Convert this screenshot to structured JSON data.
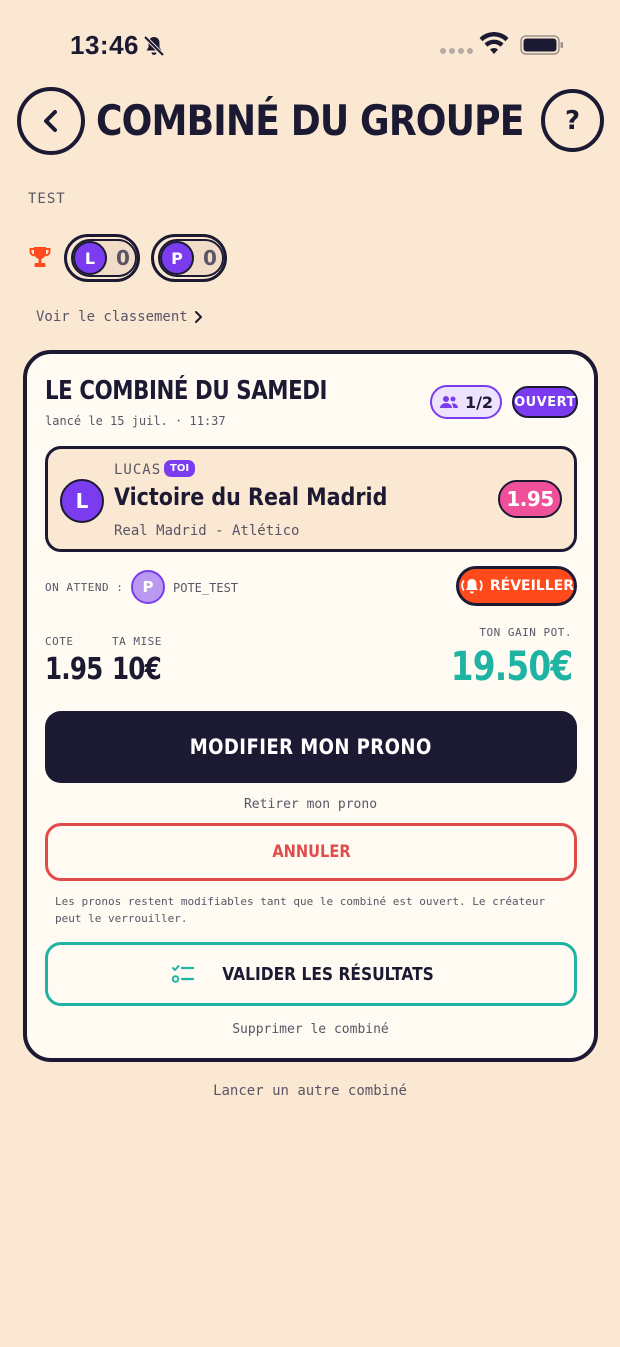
{
  "status_bar": {
    "time": "13:46"
  },
  "header": {
    "title": "COMBINÉ DU GROUPE",
    "help": "?"
  },
  "group": {
    "name": "TEST",
    "players": [
      {
        "initial": "L",
        "score": "0"
      },
      {
        "initial": "P",
        "score": "0"
      }
    ],
    "leaderboard_link": "Voir le classement"
  },
  "card": {
    "title": "LE COMBINÉ DU SAMEDI",
    "launched": "lancé le 15 juil. · 11:37",
    "participants": "1/2",
    "status": "OUVERT",
    "bet": {
      "initial": "L",
      "bettor": "LUCAS",
      "you_tag": "TOI",
      "selection": "Victoire du Real Madrid",
      "match": "Real Madrid - Atlético",
      "odds": "1.95"
    },
    "waiting": {
      "label": "ON ATTEND :",
      "initial": "P",
      "name": "POTE_TEST",
      "wake_button": "RÉVEILLER"
    },
    "stats": {
      "odds_label": "COTE",
      "odds_value": "1.95",
      "stake_label": "TA MISE",
      "stake_value": "10€",
      "gain_label": "TON GAIN POT.",
      "gain_value": "19.50€"
    },
    "modify_button": "MODIFIER MON PRONO",
    "withdraw_link": "Retirer mon prono",
    "cancel_button": "ANNULER",
    "info_text": "Les pronos restent modifiables tant que le combiné est ouvert. Le créateur peut le verrouiller.",
    "validate_button": "VALIDER LES RÉSULTATS",
    "delete_link": "Supprimer le combiné"
  },
  "footer": {
    "new_combo_link": "Lancer un autre combiné"
  },
  "colors": {
    "background": "#fbe8d3",
    "ink": "#1c1a33",
    "purple": "#7b3cf0",
    "pink": "#f0509a",
    "orange": "#ff4a1c",
    "teal": "#1fb3a3",
    "red": "#e04b4b"
  }
}
